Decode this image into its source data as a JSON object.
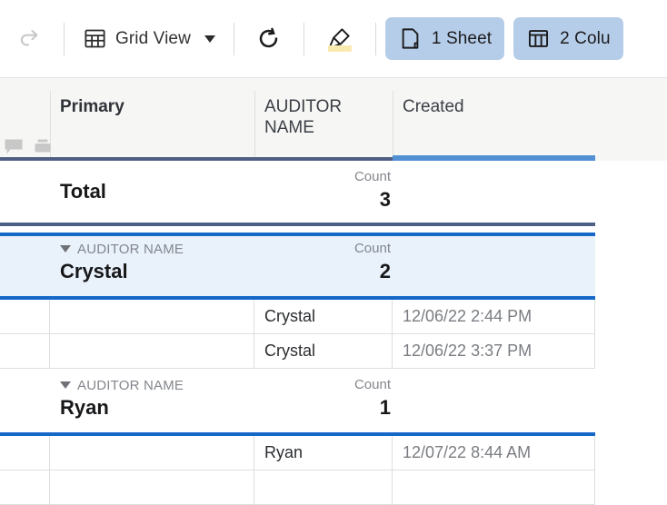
{
  "toolbar": {
    "redo": {
      "label": "",
      "icon": "redo-icon",
      "disabled": true
    },
    "view_selector": {
      "label": "Grid View",
      "icon": "grid-view-icon"
    },
    "refresh": {
      "label": "",
      "icon": "refresh-icon"
    },
    "highlighter": {
      "label": "",
      "icon": "highlighter-icon",
      "swatch_color": "#fbeab0"
    },
    "sheet_pill": {
      "label": "1 Sheet",
      "icon": "sheet-icon"
    },
    "column_pill": {
      "label": "2 Colu",
      "icon": "columns-icon"
    },
    "pill_color": "#b6cdea"
  },
  "grid": {
    "columns": [
      {
        "key": "gutter",
        "label": ""
      },
      {
        "key": "primary",
        "label": "Primary"
      },
      {
        "key": "auditor_name",
        "label": "AUDITOR NAME"
      },
      {
        "key": "created",
        "label": "Created",
        "active": true
      }
    ],
    "corner_icons": [
      "comment-icon",
      "attachment-icon"
    ],
    "active_column_color": "#5190d3",
    "header_rule_color": "#4e5f86",
    "group_border_color": "#1668c8",
    "selected_row_color": "#e9f1fb",
    "total_row": {
      "label": "Total",
      "count_label": "Count",
      "count_value": "3"
    },
    "groups": [
      {
        "kicker": "AUDITOR NAME",
        "value": "Crystal",
        "count_label": "Count",
        "count_value": "2",
        "selected": true,
        "rows": [
          {
            "gutter": "",
            "primary": "",
            "auditor_name": "Crystal",
            "created": "12/06/22 2:44 PM"
          },
          {
            "gutter": "",
            "primary": "",
            "auditor_name": "Crystal",
            "created": "12/06/22 3:37 PM"
          }
        ]
      },
      {
        "kicker": "AUDITOR NAME",
        "value": "Ryan",
        "count_label": "Count",
        "count_value": "1",
        "selected": false,
        "rows": [
          {
            "gutter": "",
            "primary": "",
            "auditor_name": "Ryan",
            "created": "12/07/22 8:44 AM"
          },
          {
            "gutter": "",
            "primary": "",
            "auditor_name": "",
            "created": ""
          }
        ]
      }
    ]
  }
}
